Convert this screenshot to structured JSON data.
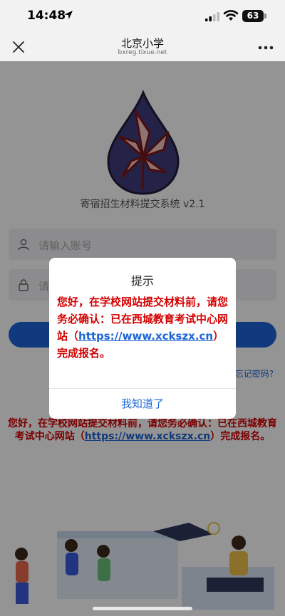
{
  "status_bar": {
    "time": "14:48",
    "battery": "63"
  },
  "nav": {
    "title": "北京小学",
    "domain": "bxreg.tixue.net"
  },
  "page": {
    "app_name": "寄宿招生材料提交系统 v2.1",
    "account_placeholder": "请输入账号",
    "password_placeholder": "请",
    "forgot": "忘记密码?",
    "notice_pre": "您好，在学校网站提交材料前，请您务必确认：已在西城教育考试中心网站（",
    "notice_link": "https://www.xckszx.cn",
    "notice_post": "）完成报名。"
  },
  "dialog": {
    "title": "提示",
    "msg_pre": "您好，在学校网站提交材料前，请您务必确认：已在西城教育考试中心网站（",
    "msg_link": "https://www.xckszx.cn",
    "msg_post": "）完成报名。",
    "button": "我知道了"
  },
  "colors": {
    "notice_red": "#d40000",
    "link_blue": "#1c64d8",
    "primary": "#1c64d8"
  }
}
